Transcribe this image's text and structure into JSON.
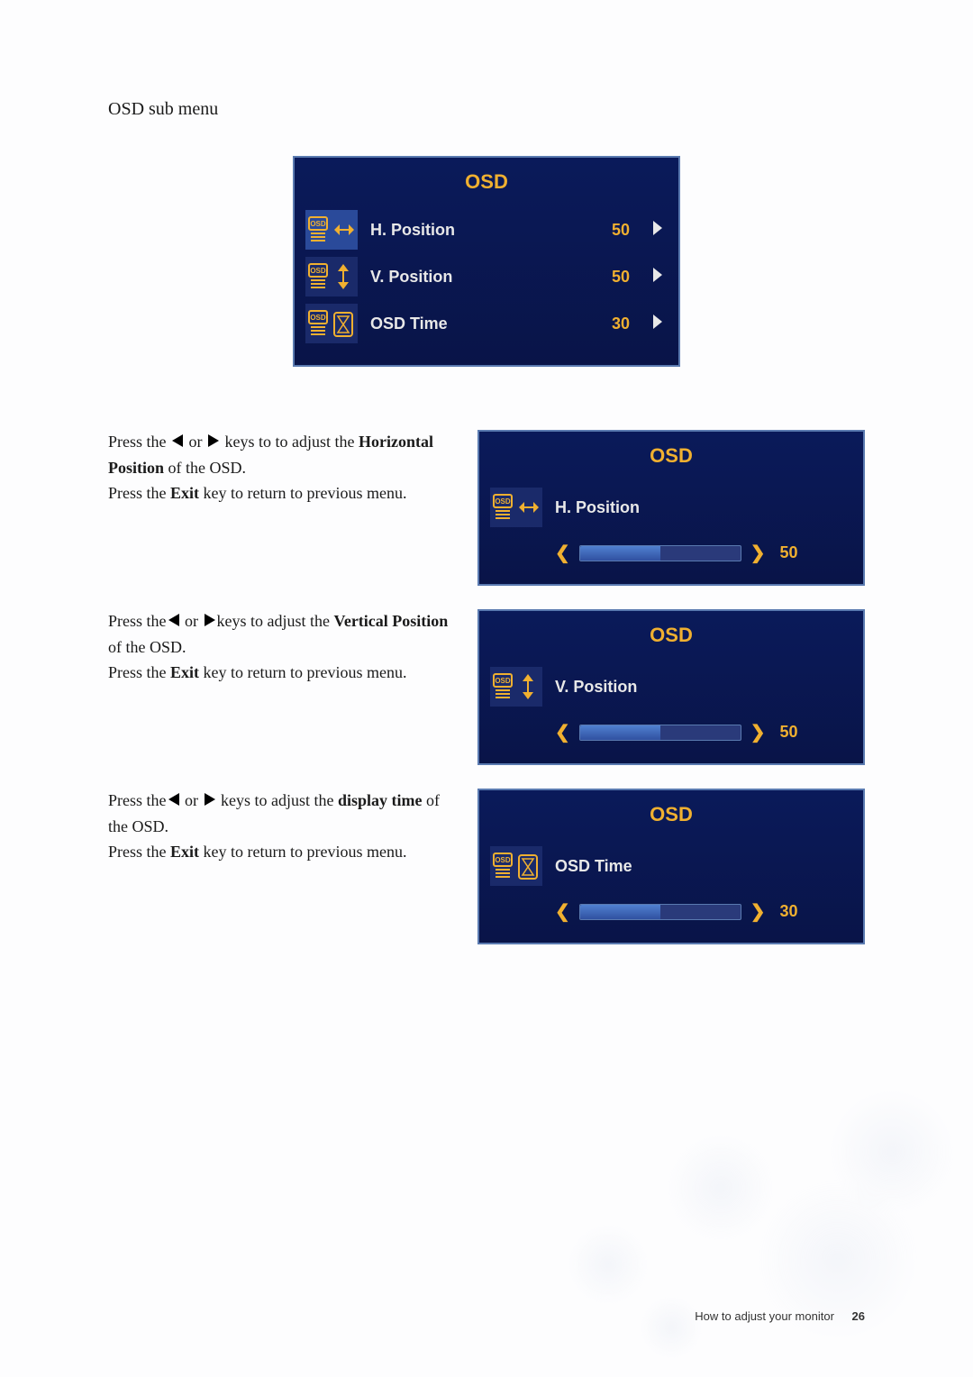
{
  "section_title": "OSD sub menu",
  "osd_main": {
    "title": "OSD",
    "rows": [
      {
        "label": "H. Position",
        "value": "50",
        "icon": "hpos",
        "selected": true
      },
      {
        "label": "V. Position",
        "value": "50",
        "icon": "vpos",
        "selected": false
      },
      {
        "label": "OSD Time",
        "value": "30",
        "icon": "time",
        "selected": false
      }
    ]
  },
  "instructions": [
    {
      "pre": "Press the ",
      "mid": " or ",
      "post1": " keys to to adjust the ",
      "bold1": "Horizontal Position",
      "post2": " of the OSD.",
      "press_exit": "Press the ",
      "exit_bold": "Exit",
      "exit_tail": " key to return to previous menu.",
      "panel": {
        "title": "OSD",
        "label": "H. Position",
        "icon": "hpos",
        "value": "50",
        "fill": 50
      }
    },
    {
      "pre": "Press the",
      "mid": " or ",
      "post1": "keys to adjust the ",
      "bold1": "Vertical Position",
      "post2": " of the OSD.",
      "press_exit": "Press the ",
      "exit_bold": "Exit",
      "exit_tail": " key to return to previous menu.",
      "panel": {
        "title": "OSD",
        "label": "V. Position",
        "icon": "vpos",
        "value": "50",
        "fill": 50
      }
    },
    {
      "pre": "Press the",
      "mid": " or ",
      "post1": " keys to adjust the ",
      "bold1": "display time",
      "post2": " of the OSD.",
      "press_exit": "Press the ",
      "exit_bold": "Exit",
      "exit_tail": " key to return to previous menu.",
      "panel": {
        "title": "OSD",
        "label": "OSD Time",
        "icon": "time",
        "value": "30",
        "fill": 50
      }
    }
  ],
  "footer": {
    "text": "How to adjust your monitor",
    "page": "26"
  }
}
